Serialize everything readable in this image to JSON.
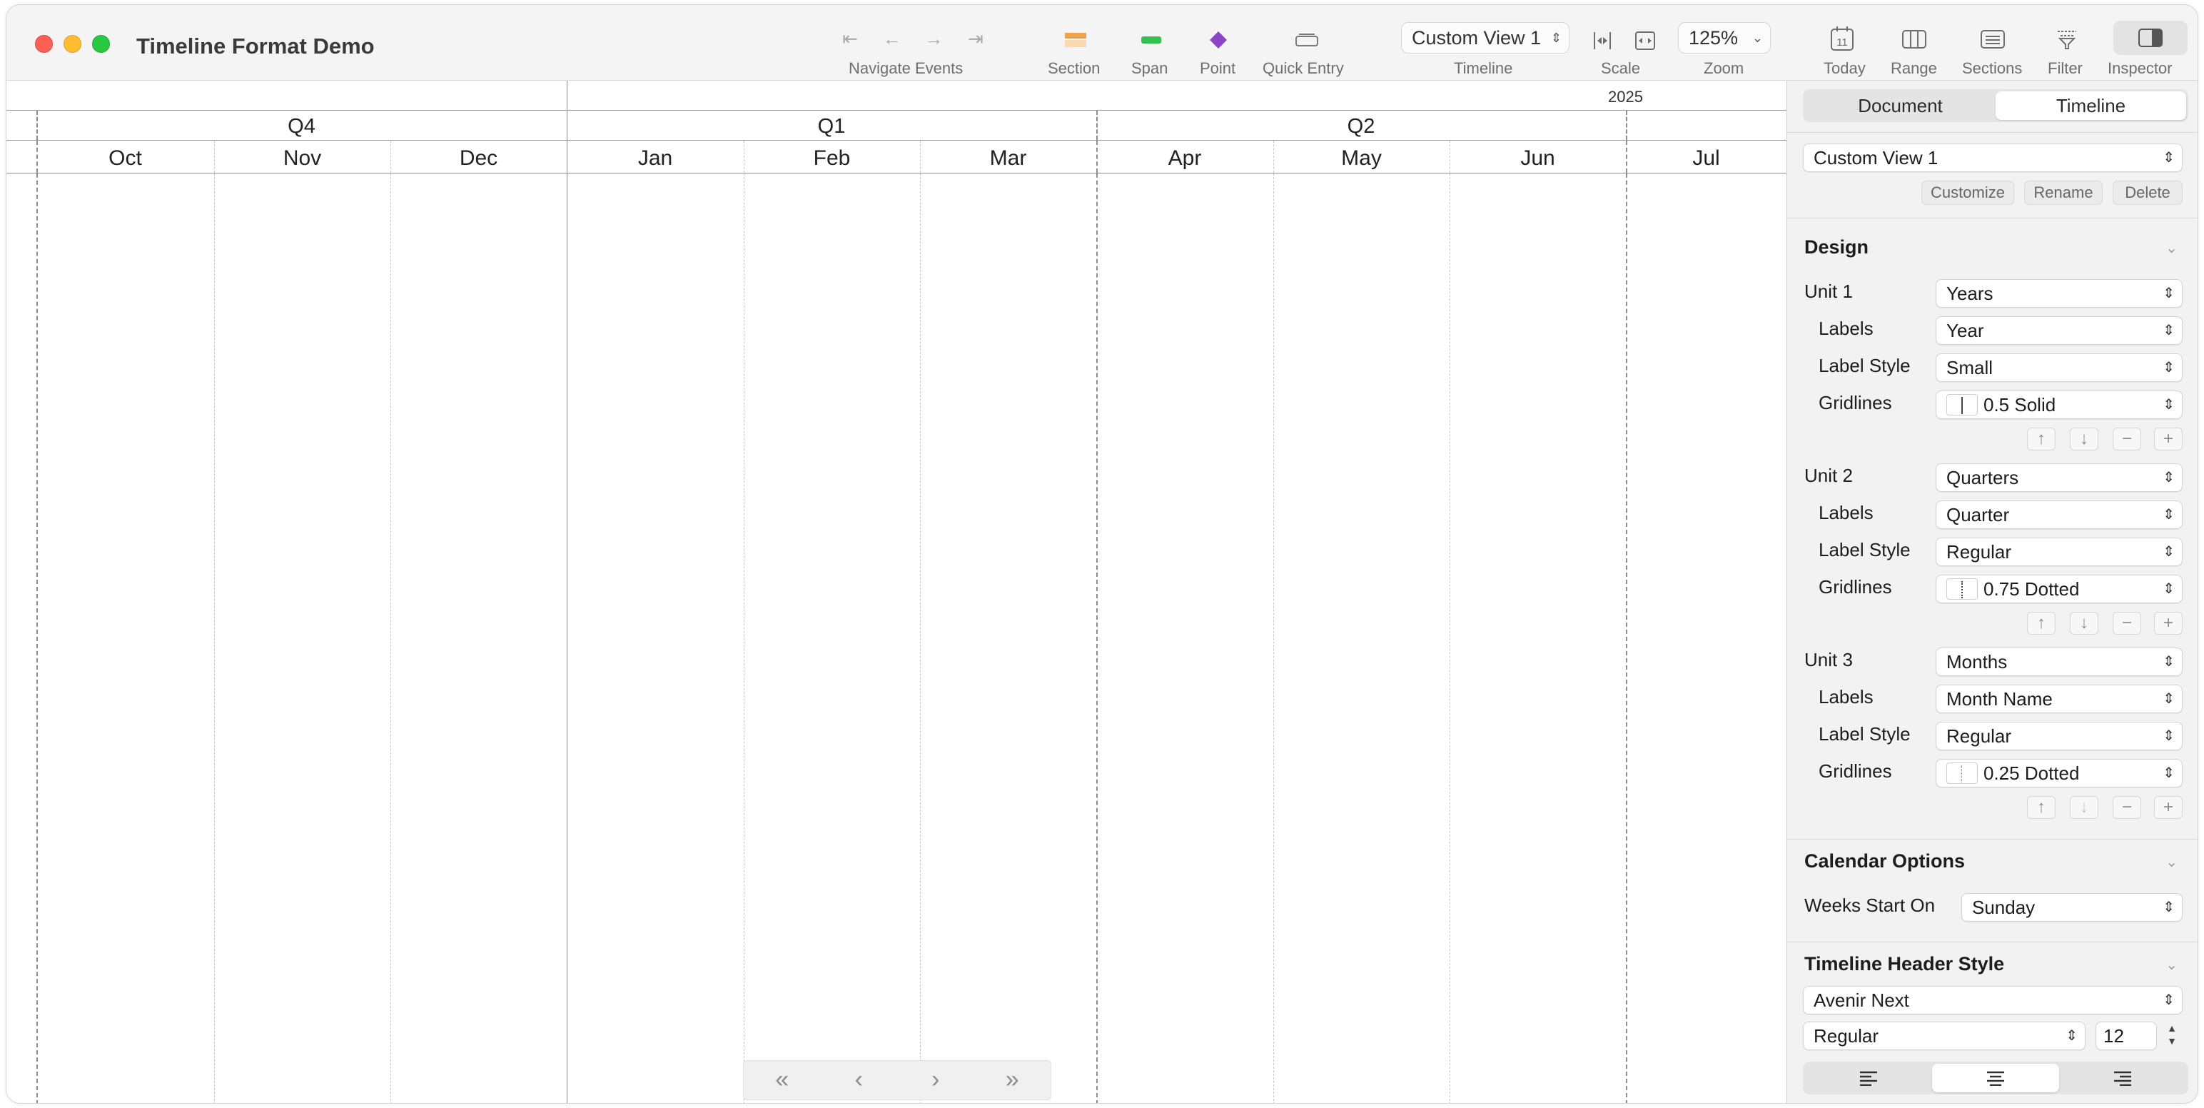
{
  "window": {
    "title": "Timeline Format Demo"
  },
  "toolbar": {
    "navigate_label": "Navigate Events",
    "nav_icons": [
      "skip-back-icon",
      "arrow-left-icon",
      "arrow-right-icon",
      "skip-forward-icon"
    ],
    "section_label": "Section",
    "span_label": "Span",
    "point_label": "Point",
    "quick_entry_label": "Quick Entry",
    "timeline_value": "Custom View 1",
    "timeline_label": "Timeline",
    "scale_label": "Scale",
    "zoom_value": "125%",
    "zoom_label": "Zoom",
    "today_label": "Today",
    "today_icon_text": "11",
    "range_label": "Range",
    "sections_label": "Sections",
    "filter_label": "Filter",
    "inspector_label": "Inspector",
    "colors": {
      "section": "#f0a24a",
      "span": "#33c24d",
      "point": "#8e44c8"
    }
  },
  "timeline": {
    "year_label": "2025",
    "quarters": [
      "Q4",
      "Q1",
      "Q2"
    ],
    "months": [
      "Oct",
      "Nov",
      "Dec",
      "Jan",
      "Feb",
      "Mar",
      "Apr",
      "May",
      "Jun",
      "Jul"
    ],
    "pager": [
      "«",
      "‹",
      "›",
      "»"
    ]
  },
  "inspector": {
    "tabs": [
      "Document",
      "Timeline"
    ],
    "active_tab": "Timeline",
    "view_select": "Custom View 1",
    "view_buttons": [
      "Customize",
      "Rename",
      "Delete"
    ],
    "design": {
      "title": "Design",
      "units": [
        {
          "name": "Unit 1",
          "unit": "Years",
          "labels": "Year",
          "label_style": "Small",
          "gridlines": "0.5 Solid"
        },
        {
          "name": "Unit 2",
          "unit": "Quarters",
          "labels": "Quarter",
          "label_style": "Regular",
          "gridlines": "0.75 Dotted"
        },
        {
          "name": "Unit 3",
          "unit": "Months",
          "labels": "Month Name",
          "label_style": "Regular",
          "gridlines": "0.25 Dotted"
        }
      ],
      "field_labels": {
        "labels": "Labels",
        "label_style": "Label Style",
        "gridlines": "Gridlines"
      }
    },
    "calendar": {
      "title": "Calendar Options",
      "weeks_start_label": "Weeks Start On",
      "weeks_start_value": "Sunday"
    },
    "header_style": {
      "title": "Timeline Header Style",
      "font": "Avenir Next",
      "weight": "Regular",
      "size": "12",
      "alignment": "center"
    }
  }
}
